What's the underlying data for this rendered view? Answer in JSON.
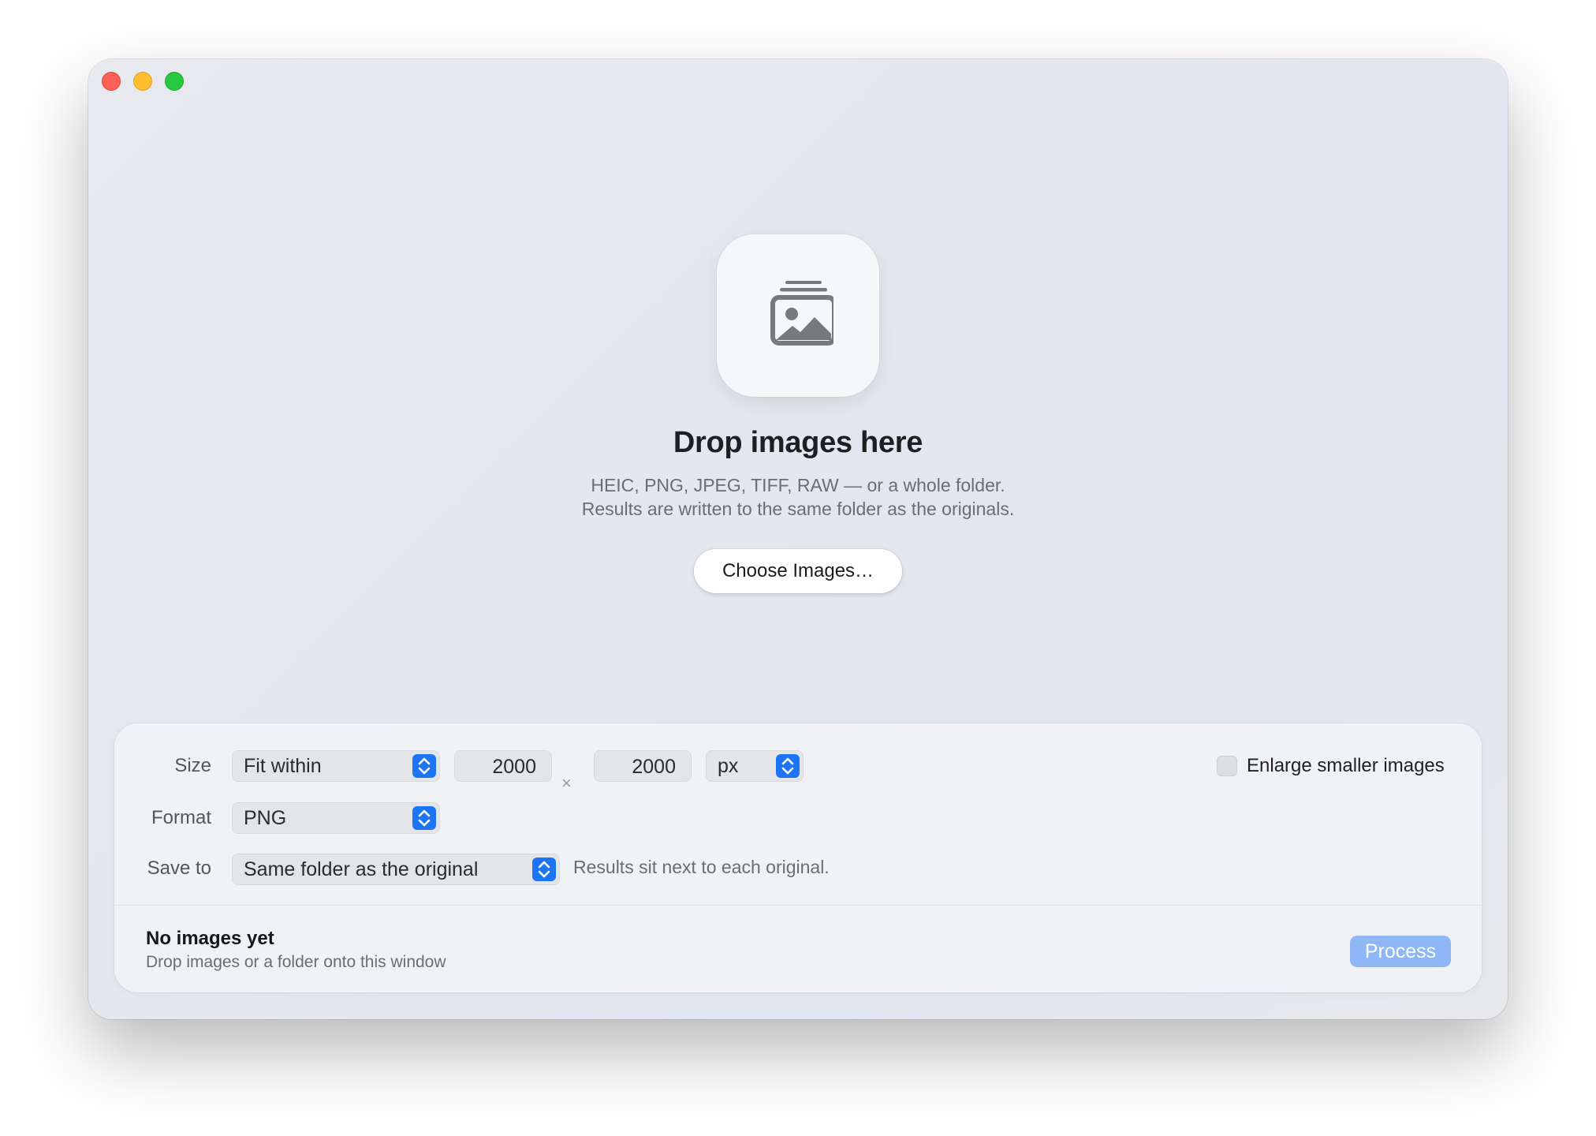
{
  "window": {
    "traffic_lights": [
      "close",
      "minimize",
      "zoom"
    ]
  },
  "drop_zone": {
    "icon": "photo-stack-icon",
    "title": "Drop images here",
    "subtitle_line1": "HEIC, PNG, JPEG, TIFF, RAW — or a whole folder.",
    "subtitle_line2": "Results are written to the same folder as the originals.",
    "choose_button": "Choose Images…"
  },
  "settings": {
    "size": {
      "label": "Size",
      "mode": "Fit within",
      "width": "2000",
      "separator": "×",
      "height": "2000",
      "unit": "px"
    },
    "enlarge": {
      "label": "Enlarge smaller images",
      "checked": false
    },
    "format": {
      "label": "Format",
      "value": "PNG"
    },
    "save_to": {
      "label": "Save to",
      "value": "Same folder as the original",
      "hint": "Results sit next to each original."
    }
  },
  "status": {
    "title": "No images yet",
    "subtitle": "Drop images or a folder onto this window",
    "process_button": "Process"
  },
  "colors": {
    "accent": "#1d74f5",
    "process_disabled": "#8fb7f6",
    "close": "#fe5f57",
    "minimize": "#febc2e",
    "zoom": "#28c840"
  }
}
